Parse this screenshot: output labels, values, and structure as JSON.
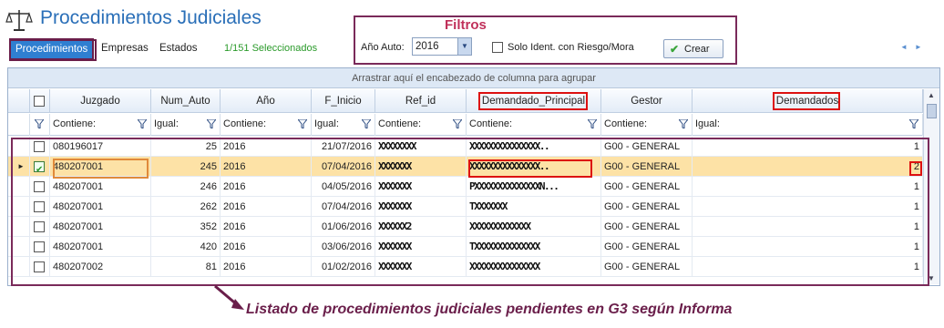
{
  "app": {
    "title": "Procedimientos Judiciales"
  },
  "tabs": [
    {
      "label": "Procedimientos",
      "active": true
    },
    {
      "label": "Empresas",
      "active": false
    },
    {
      "label": "Estados",
      "active": false
    }
  ],
  "selection_count": "1/151 Seleccionados",
  "filters": {
    "title": "Filtros",
    "ano_label": "Año Auto:",
    "ano_value": "2016",
    "riesgo_label": "Solo Ident. con Riesgo/Mora",
    "riesgo_checked": false,
    "crear_label": "Crear"
  },
  "grid": {
    "group_hint": "Arrastrar aquí el encabezado de columna para agrupar",
    "columns": [
      "Juzgado",
      "Num_Auto",
      "Año",
      "F_Inicio",
      "Ref_id",
      "Demandado_Principal",
      "Gestor",
      "Demandados"
    ],
    "filters": [
      "Contiene:",
      "Igual:",
      "Contiene:",
      "Igual:",
      "Contiene:",
      "Contiene:",
      "Contiene:",
      "Igual:"
    ],
    "rows": [
      {
        "checked": false,
        "selected": false,
        "juzgado": "080196017",
        "num_auto": "25",
        "ano": "2016",
        "f_inicio": "21/07/2016",
        "ref_id": "XXXXXXXX",
        "demandado": "XXXXXXXXXXXXXXX..",
        "gestor": "G00 - GENERAL",
        "demandados": "1"
      },
      {
        "checked": true,
        "selected": true,
        "juzgado": "480207001",
        "num_auto": "245",
        "ano": "2016",
        "f_inicio": "07/04/2016",
        "ref_id": "XXXXXXX",
        "demandado": "XXXXXXXXXXXXXXX..",
        "gestor": "G00 - GENERAL",
        "demandados": "2"
      },
      {
        "checked": false,
        "selected": false,
        "juzgado": "480207001",
        "num_auto": "246",
        "ano": "2016",
        "f_inicio": "04/05/2016",
        "ref_id": "XXXXXXX",
        "demandado": "PXXXXXXXXXXXXXXN...",
        "gestor": "G00 - GENERAL",
        "demandados": "1"
      },
      {
        "checked": false,
        "selected": false,
        "juzgado": "480207001",
        "num_auto": "262",
        "ano": "2016",
        "f_inicio": "07/04/2016",
        "ref_id": "XXXXXXX",
        "demandado": "TXXXXXXX",
        "gestor": "G00 - GENERAL",
        "demandados": "1"
      },
      {
        "checked": false,
        "selected": false,
        "juzgado": "480207001",
        "num_auto": "352",
        "ano": "2016",
        "f_inicio": "01/06/2016",
        "ref_id": "XXXXXX2",
        "demandado": "XXXXXXXXXXXXX",
        "gestor": "G00 - GENERAL",
        "demandados": "1"
      },
      {
        "checked": false,
        "selected": false,
        "juzgado": "480207001",
        "num_auto": "420",
        "ano": "2016",
        "f_inicio": "03/06/2016",
        "ref_id": "XXXXXXX",
        "demandado": "TXXXXXXXXXXXXXX",
        "gestor": "G00 - GENERAL",
        "demandados": "1"
      },
      {
        "checked": false,
        "selected": false,
        "juzgado": "480207002",
        "num_auto": "81",
        "ano": "2016",
        "f_inicio": "01/02/2016",
        "ref_id": "XXXXXXX",
        "demandado": "XXXXXXXXXXXXXXX",
        "gestor": "G00 - GENERAL",
        "demandados": "1"
      }
    ]
  },
  "caption": "Listado de procedimientos judiciales pendientes en G3 según Informa",
  "colors": {
    "accent": "#2f7fd1",
    "selected_row": "#fde2a6",
    "annotation": "#7a2a5a",
    "highlight": "#dd1111"
  }
}
